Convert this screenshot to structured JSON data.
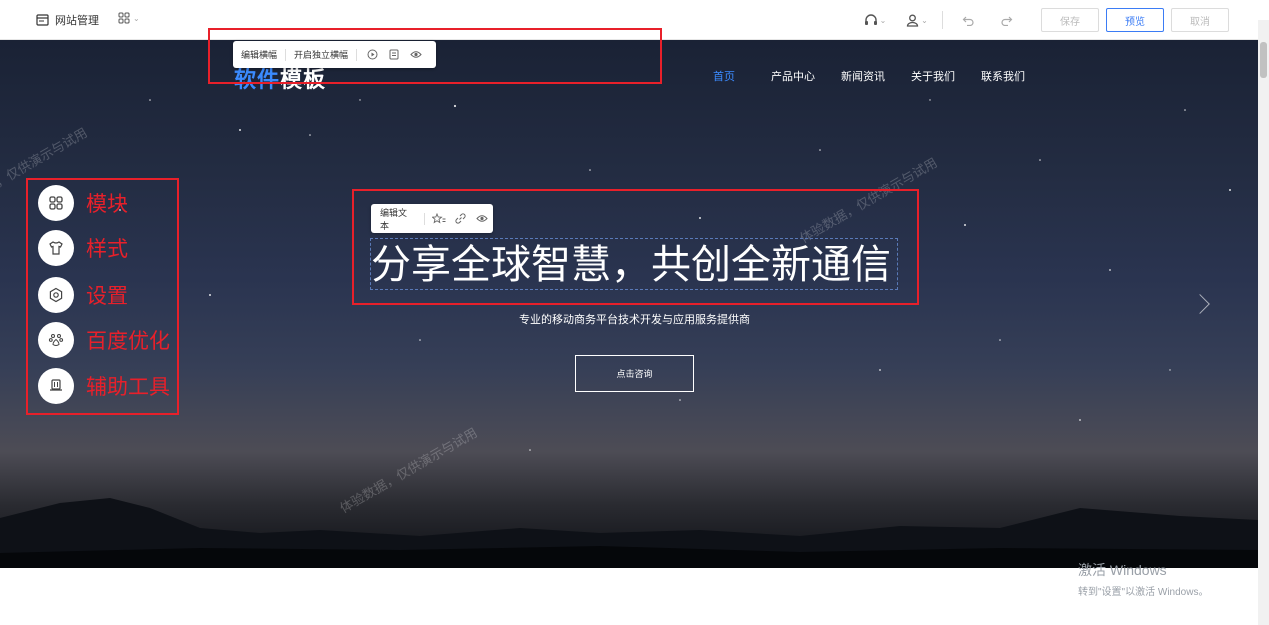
{
  "topbar": {
    "site_manage_label": "网站管理",
    "save_label": "保存",
    "preview_label": "预览",
    "cancel_label": "取消"
  },
  "site": {
    "logo_accent": "软件",
    "logo_rest": "模板",
    "nav": [
      "首页",
      "产品中心",
      "新闻资讯",
      "关于我们",
      "联系我们"
    ],
    "active_nav": 0
  },
  "band_toolbar": {
    "edit_band": "编辑横幅",
    "independent_band": "开启独立横幅"
  },
  "text_toolbar": {
    "edit_text": "编辑文本"
  },
  "hero": {
    "headline": "分享全球智慧，共创全新通信",
    "subtitle": "专业的移动商务平台技术开发与应用服务提供商",
    "cta_label": "点击咨询",
    "watermarks": [
      "体验数据，仅供演示与试用",
      "体验数据，仅供演示与试用",
      "体验数据，仅供演示与试用"
    ]
  },
  "side_menu": {
    "items": [
      {
        "label": "模块",
        "icon": "modules-icon"
      },
      {
        "label": "样式",
        "icon": "shirt-icon"
      },
      {
        "label": "设置",
        "icon": "gear-icon"
      },
      {
        "label": "百度优化",
        "icon": "baidu-paw-icon"
      },
      {
        "label": "辅助工具",
        "icon": "toolkit-icon"
      }
    ]
  },
  "windows_activation": {
    "title": "激活 Windows",
    "subtitle": "转到\"设置\"以激活 Windows。"
  },
  "colors": {
    "accent": "#3b8bff",
    "annotation_red": "#e8202a",
    "primary_button": "#3b7cf5"
  }
}
